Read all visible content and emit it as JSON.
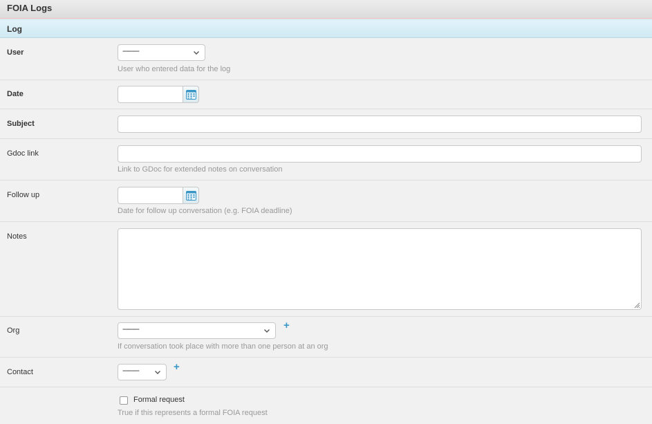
{
  "header": {
    "title": "FOIA Logs"
  },
  "section": {
    "title": "Log"
  },
  "fields": {
    "user": {
      "label": "User",
      "value": "---------",
      "help": "User who entered data for the log"
    },
    "date": {
      "label": "Date",
      "value": ""
    },
    "subject": {
      "label": "Subject",
      "value": ""
    },
    "gdoc_link": {
      "label": "Gdoc link",
      "value": "",
      "help": "Link to GDoc for extended notes on conversation"
    },
    "follow_up": {
      "label": "Follow up",
      "value": "",
      "help": "Date for follow up conversation (e.g. FOIA deadline)"
    },
    "notes": {
      "label": "Notes",
      "value": ""
    },
    "org": {
      "label": "Org",
      "value": "---------",
      "help": "If conversation took place with more than one person at an org",
      "add_icon": "+"
    },
    "contact": {
      "label": "Contact",
      "value": "---------",
      "add_icon": "+"
    },
    "formal_request": {
      "label": "Formal request",
      "checked": false,
      "help": "True if this represents a formal FOIA request"
    }
  },
  "icons": {
    "calendar": "calendar-icon",
    "dropdown": "chevron-down-icon",
    "add": "plus-icon",
    "resize": "resize-grip-icon"
  },
  "colors": {
    "accent": "#3a96c6",
    "section_bg": "#d7edf6",
    "help_text": "#999999"
  }
}
